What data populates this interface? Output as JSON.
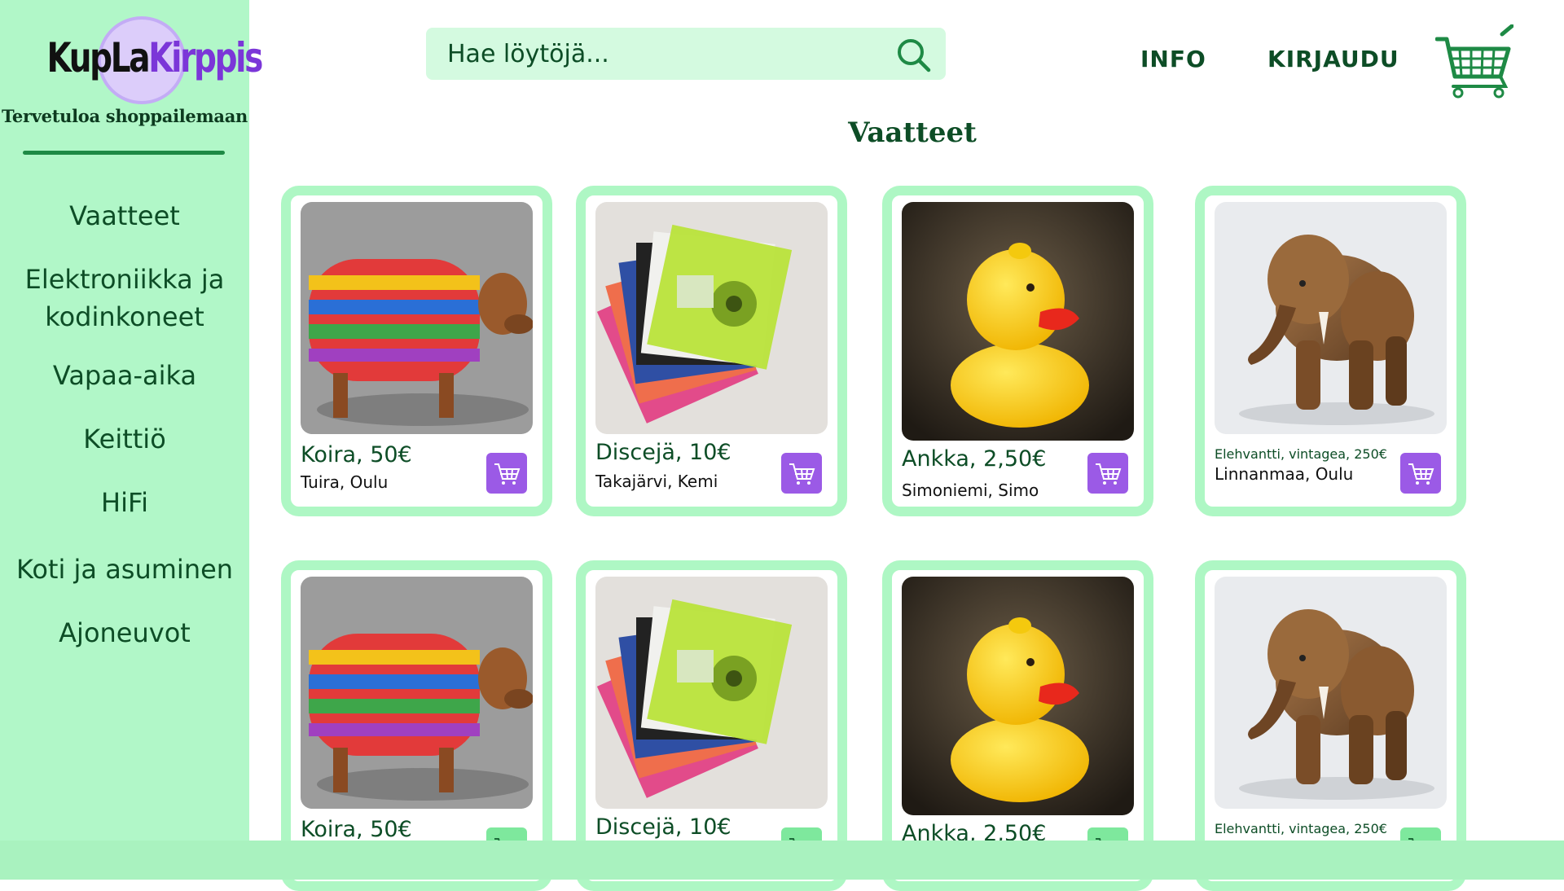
{
  "brand": {
    "logo_text_a": "KupLa",
    "logo_text_b": "Kirppis",
    "tagline": "Tervetuloa shoppailemaan"
  },
  "sidebar": {
    "items": [
      {
        "label": "Vaatteet"
      },
      {
        "label": "Elektroniikka ja kodinkoneet"
      },
      {
        "label": "Vapaa-aika"
      },
      {
        "label": "Keittiö"
      },
      {
        "label": "HiFi"
      },
      {
        "label": "Koti ja asuminen"
      },
      {
        "label": "Ajoneuvot"
      }
    ]
  },
  "header": {
    "search_placeholder": "Hae löytöjä...",
    "info_label": "INFO",
    "login_label": "KIRJAUDU",
    "search_icon": "search-icon",
    "cart_icon": "shopping-cart-icon"
  },
  "page": {
    "title": "Vaatteet"
  },
  "products": [
    {
      "title": "Koira, 50€",
      "location": "Tuira, Oulu",
      "image": "dog-in-sweater",
      "cart": "purple"
    },
    {
      "title": "Discejä, 10€",
      "location": "Takajärvi, Kemi",
      "image": "floppy-disks",
      "cart": "purple"
    },
    {
      "title": "Ankka, 2,50€",
      "location": "Simoniemi, Simo",
      "image": "rubber-duck",
      "cart": "purple"
    },
    {
      "title": "Elehvantti, vintagea, 250€",
      "location": "Linnanmaa, Oulu",
      "image": "wooden-elephant",
      "cart": "purple"
    },
    {
      "title": "Koira, 50€",
      "location": "",
      "image": "dog-in-sweater",
      "cart": "green"
    },
    {
      "title": "Discejä, 10€",
      "location": "",
      "image": "floppy-disks",
      "cart": "green"
    },
    {
      "title": "Ankka, 2,50€",
      "location": "",
      "image": "rubber-duck",
      "cart": "green"
    },
    {
      "title": "Elehvantti, vintagea, 250€",
      "location": "",
      "image": "wooden-elephant",
      "cart": "green"
    }
  ],
  "colors": {
    "sidebar_bg": "#b1f7c8",
    "card_border": "#aef7c4",
    "text_green": "#0d4d26",
    "cart_button_purple": "#9b5ae6",
    "cart_button_green": "#7ee89d"
  }
}
